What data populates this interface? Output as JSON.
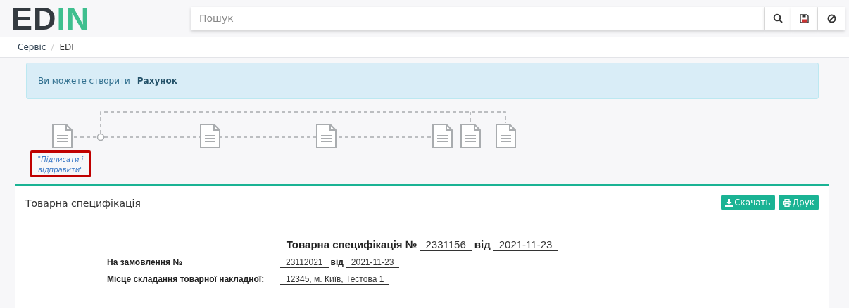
{
  "logo": {
    "main": "ED",
    "accent": "IN"
  },
  "search": {
    "placeholder": "Пошук"
  },
  "breadcrumbs": [
    "Сервіс",
    "EDI"
  ],
  "alert": {
    "text": "Ви можете створити",
    "link": "Рахунок"
  },
  "workflow": {
    "nodes": [
      {
        "kind": "document",
        "note": "\"Підписати і відправити\""
      },
      {
        "kind": "document"
      },
      {
        "kind": "document"
      },
      {
        "kind": "document"
      },
      {
        "kind": "document"
      },
      {
        "kind": "document"
      }
    ]
  },
  "panel": {
    "title": "Товарна специфікація",
    "buttons": [
      {
        "kind": "download",
        "label": "Скачать"
      },
      {
        "kind": "print",
        "label": "Друк"
      }
    ]
  },
  "document": {
    "title": "Товарна специфікація №",
    "number": "2331156",
    "date_word": "від",
    "date": "2021-11-23",
    "rows": [
      {
        "label": "На замовлення №",
        "value": "23112021",
        "date_word": "від",
        "date": "2021-11-23"
      },
      {
        "label": "Місце складання товарної накладної:",
        "value": "12345, м. Київ, Тестова 1"
      }
    ]
  }
}
